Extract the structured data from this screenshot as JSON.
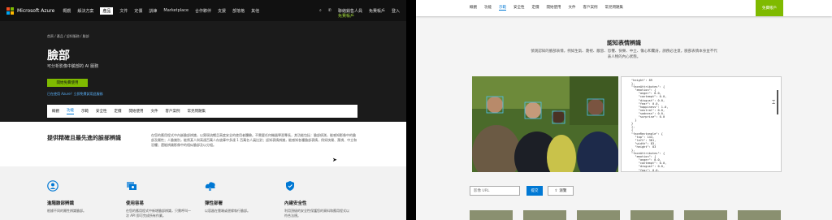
{
  "left": {
    "nav": {
      "brand": "Microsoft Azure",
      "items": [
        "概觀",
        "解決方案",
        "產品",
        "文件",
        "定價",
        "訓練",
        "Marketplace",
        "合作夥伴",
        "支援",
        "部落格",
        "其他"
      ],
      "active_index": 2,
      "contact": "聯絡銷售人員",
      "signin": "登入",
      "free_account": "免費帳戶"
    },
    "breadcrumb": "首頁 / 產品 / 認知服務 / 臉部",
    "title": "臉部",
    "subtitle": "可分析影像中臉部的 AI 服務",
    "cta": "開始免費使用",
    "cta_link": "已在使用 Azure？立即免費試用此服務",
    "tabs": [
      "概觀",
      "功能",
      "示範",
      "安全性",
      "定價",
      "開始使用",
      "文件",
      "客戶案例",
      "常見問題集"
    ],
    "active_tab": 1,
    "section_title": "提供精確且最先進的臉部辨識",
    "section_text": "在您的應用程式中內嵌臉部辨識，以實現流暢且高度安全的使用者體驗。不需要任何機器學習專長，其功能包括：臉部偵測，能感知影像中的臉部及屬性；人臉識別，能將某人與高達百萬人存放庫中多達 1 百萬名人員比對；認知表情辨識，能感知各種臉部表情，例如快樂、蔑視、中立和恐懼；還能辨識影像中的相似臉部及以分組。",
    "features": [
      {
        "title": "進階臉部辨識",
        "desc": "根據不同的屬性辨識臉部。",
        "icon": "face-recognition-icon",
        "color": "#0078d4"
      },
      {
        "title": "使用容易",
        "desc": "在您的應用程式中新增臉部辨識，只需呼叫一次 API 即可完成所有作業。",
        "icon": "api-icon",
        "color": "#0078d4"
      },
      {
        "title": "彈性部署",
        "desc": "以容器在雲端或邊緣執行臉部。",
        "icon": "cloud-deploy-icon",
        "color": "#0078d4"
      },
      {
        "title": "內建安全性",
        "desc": "利用頂級的安全性保護您的資料和應用程式以符合法規。",
        "icon": "shield-icon",
        "color": "#0078d4"
      }
    ]
  },
  "right": {
    "tabs": [
      "概觀",
      "功能",
      "示範",
      "安全性",
      "定價",
      "開始使用",
      "文件",
      "客戶案例",
      "常見問題集"
    ],
    "active_tab": 2,
    "free_account": "免費帳戶",
    "title": "認知表情辨識",
    "desc": "偵測認知的臉部表情，例如生氣、蔑視、厭惡、恐懼、快樂、中立、傷心和驚訝，請務必注意，臉部表情本身並不代表人物的內心狀態。",
    "json_text": "\"height\": 89\n},\n\"faceAttributes\": {\n  \"emotion\": {\n    \"anger\": 0.0,\n    \"contempt\": 0.0,\n    \"disgust\": 0.0,\n    \"fear\": 0.0,\n    \"happiness\": 1.0,\n    \"neutral\": 0.0,\n    \"sadness\": 0.0,\n    \"surprise\": 0.0\n  }\n}\n},\n{\n\"faceRectangle\": {\n  \"top\": 144,\n  \"left\": 381,\n  \"width\": 83,\n  \"height\": 83\n},\n\"faceAttributes\": {\n  \"emotion\": {\n    \"anger\": 0.0,\n    \"contempt\": 0.0,\n    \"disgust\": 0.0,\n    \"fear\": 0.0,\n    \"happiness\": 0.0,\n    \"neutral\": 0.98,\n    \"sadness\": 0.0,\n    \"surprise\": 0.0",
    "url_placeholder": "影像 URL",
    "submit": "提交",
    "browse": "瀏覽"
  },
  "colors": {
    "accent": "#0078d4",
    "green": "#7fba00",
    "dark": "#1b1b1b"
  }
}
